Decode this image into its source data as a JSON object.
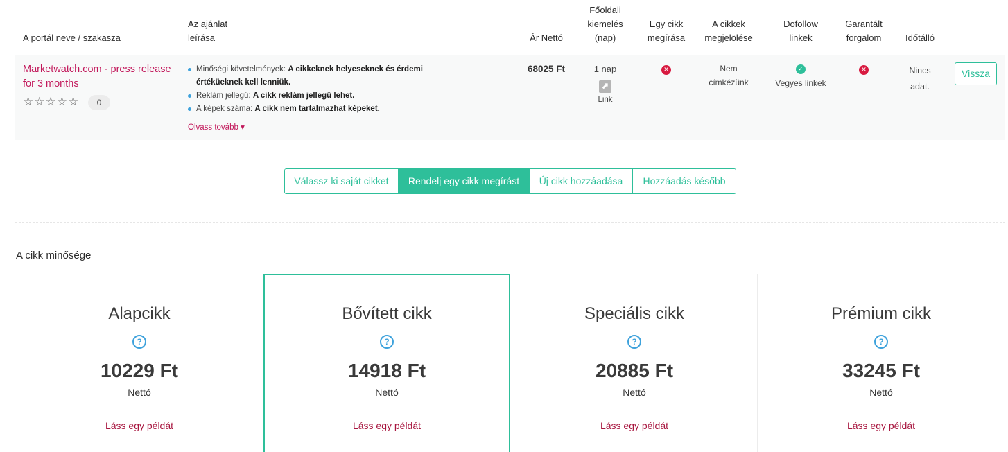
{
  "header": {
    "portal": "A portál neve / szakasza",
    "offer_line1": "Az ajánlat",
    "offer_line2": "leírása",
    "price": "Ár Nettó",
    "main_line1": "Főoldali",
    "main_line2": "kiemelés",
    "main_line3": "(nap)",
    "write_line1": "Egy cikk",
    "write_line2": "megírása",
    "tag_line1": "A cikkek",
    "tag_line2": "megjelölése",
    "dofollow_line1": "Dofollow",
    "dofollow_line2": "linkek",
    "traffic_line1": "Garantált",
    "traffic_line2": "forgalom",
    "durable": "Időtálló"
  },
  "row": {
    "portal_name": "Marketwatch.com - press release for 3 months",
    "stars": "☆☆☆☆☆",
    "review_count": "0",
    "req1_key": "Minőségi követelmények:",
    "req1_val": "A cikkeknek helyeseknek és érdemi értéküeknek kell lenniük.",
    "req2_key": "Reklám jellegű:",
    "req2_val": "A cikk reklám jellegű lehet.",
    "req3_key": "A képek száma:",
    "req3_val": "A cikk nem tartalmazhat képeket.",
    "read_more": "Olvass tovább ▾",
    "price": "68025 Ft",
    "main_days": "1 nap",
    "link_label": "Link",
    "tag_line1": "Nem",
    "tag_line2": "címkézünk",
    "dofollow": "Vegyes linkek",
    "durable_line1": "Nincs",
    "durable_line2": "adat.",
    "back_button": "Vissza"
  },
  "segments": [
    {
      "label": "Válassz ki saját cikket",
      "active": false
    },
    {
      "label": "Rendelj egy cikk megírást",
      "active": true
    },
    {
      "label": "Új cikk hozzáadása",
      "active": false
    },
    {
      "label": "Hozzáadás később",
      "active": false
    }
  ],
  "quality": {
    "title": "A cikk minősége",
    "cards": [
      {
        "name": "Alapcikk",
        "price": "10229 Ft",
        "net": "Nettó",
        "example": "Láss egy példát"
      },
      {
        "name": "Bővített cikk",
        "price": "14918 Ft",
        "net": "Nettó",
        "example": "Láss egy példát"
      },
      {
        "name": "Speciális cikk",
        "price": "20885 Ft",
        "net": "Nettó",
        "example": "Láss egy példát"
      },
      {
        "name": "Prémium cikk",
        "price": "33245 Ft",
        "net": "Nettó",
        "example": "Láss egy példát"
      }
    ]
  },
  "icons": {
    "help": "?",
    "cross": "✕",
    "check": "✓",
    "external": "⬈"
  },
  "colors": {
    "accent": "#2ebf9a",
    "link_red": "#c2185b",
    "error": "#d81b41",
    "info_blue": "#3ea2dc"
  }
}
